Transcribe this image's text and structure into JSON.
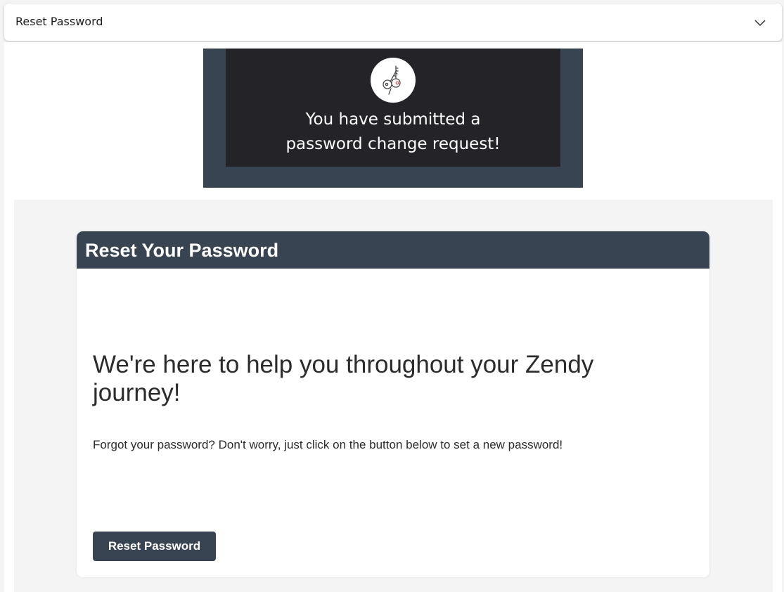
{
  "header": {
    "title": "Reset Password",
    "expand_icon": "chevron-down-icon"
  },
  "banner": {
    "icon": "keys-icon",
    "line1": "You have submitted a",
    "line2": "password change request!"
  },
  "card": {
    "title": "Reset Your Password",
    "heading": "We're here to help you throughout your Zendy journey!",
    "description": "Forgot your password? Don't worry, just click on the button below to set a new password!",
    "button_label": "Reset Password"
  },
  "colors": {
    "brand_dark": "#394452",
    "banner_inner": "#232328",
    "background": "#f4f4f4"
  }
}
